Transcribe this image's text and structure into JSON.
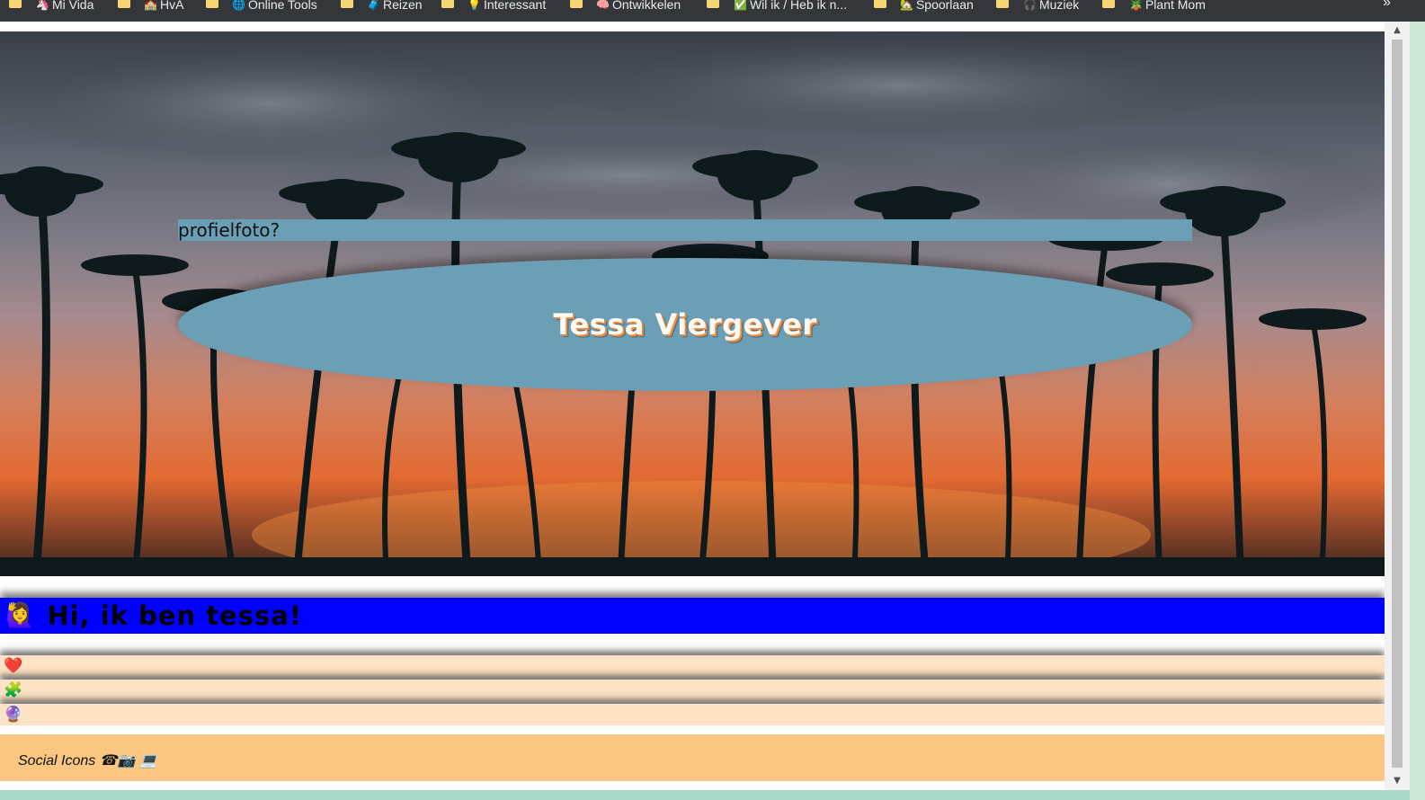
{
  "bookmarks": [
    {
      "icon": "🦄",
      "label": "Mi Vida"
    },
    {
      "icon": "🏫",
      "label": "HvA"
    },
    {
      "icon": "🌐",
      "label": "Online Tools"
    },
    {
      "icon": "🧳",
      "label": "Reizen"
    },
    {
      "icon": "💡",
      "label": "Interessant"
    },
    {
      "icon": "🧠",
      "label": "Ontwikkelen"
    },
    {
      "icon": "✅",
      "label": "Wil ik / Heb ik n..."
    },
    {
      "icon": "🏡",
      "label": "Spoorlaan"
    },
    {
      "icon": "🎧",
      "label": "Muziek"
    },
    {
      "icon": "🪴",
      "label": "Plant Mom"
    }
  ],
  "bookmarks_overflow": "»",
  "hero": {
    "profile_label": "profielfoto?",
    "name": "Tessa Viergever"
  },
  "intro": {
    "emoji": "🙋‍♀️",
    "title": "Hi, ik ben tessa!"
  },
  "rows": [
    {
      "emoji": "❤️"
    },
    {
      "emoji": "🧩"
    },
    {
      "emoji": "🔮"
    }
  ],
  "footer": {
    "text": "Social Icons ☎📷 💻"
  },
  "colors": {
    "intro_bg": "#0000ff",
    "name_box_bg": "#6b9fb5",
    "rows_bg": "#fde3c5",
    "footer_bg": "#f9c781"
  }
}
